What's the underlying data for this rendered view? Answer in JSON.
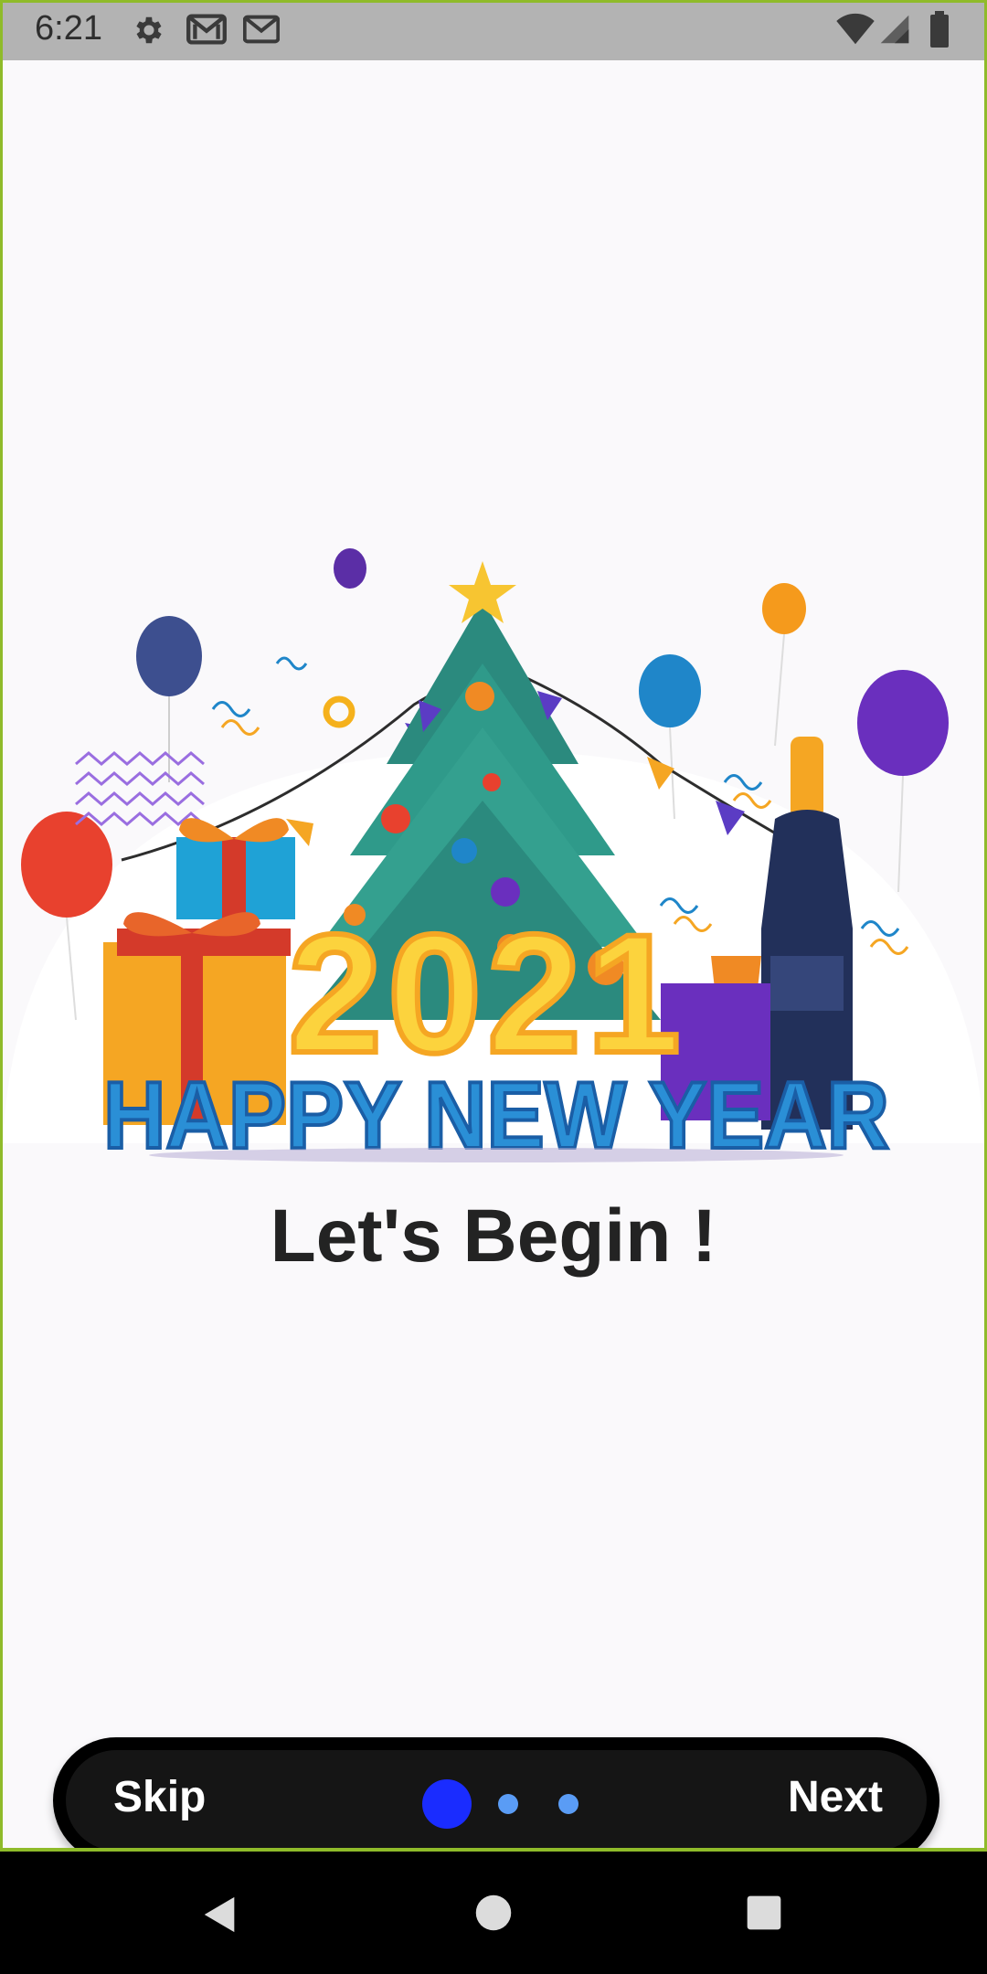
{
  "status_bar": {
    "time": "6:21",
    "icons_left": [
      "gear-icon",
      "gmail-icon",
      "gmail-icon"
    ],
    "icons_right": [
      "wifi-icon",
      "signal-icon",
      "battery-icon"
    ]
  },
  "illustration": {
    "year_text": "2021",
    "banner_text": "HAPPY NEW YEAR"
  },
  "headline": "Let's Begin !",
  "onboarding_nav": {
    "skip_label": "Skip",
    "next_label": "Next",
    "page_count": 3,
    "current_page": 1,
    "active_dot_color": "#1a2cff",
    "inactive_dot_color": "#5a9cf5"
  },
  "colors": {
    "status_bar": "#b3b3b3",
    "background": "#faf9fb",
    "pill_background": "#151515",
    "frame_border": "#8fbb2a"
  }
}
